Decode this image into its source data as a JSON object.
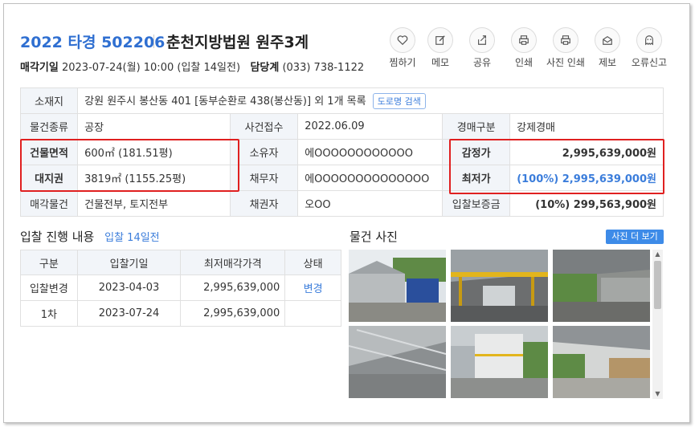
{
  "header": {
    "case_no": "2022 타경 502206",
    "court": "춘천지방법원 원주3계",
    "sale_date_label": "매각기일",
    "sale_date_value": "2023-07-24(월) 10:00 (입찰 14일전)",
    "manager_label": "담당계",
    "manager_value": "(033) 738-1122"
  },
  "actions": [
    {
      "label": "찜하기",
      "icon": "heart-icon"
    },
    {
      "label": "메모",
      "icon": "pencil-icon"
    },
    {
      "label": "공유",
      "icon": "share-icon"
    },
    {
      "label": "인쇄",
      "icon": "printer-icon"
    },
    {
      "label": "사진 인쇄",
      "icon": "printer-icon"
    },
    {
      "label": "제보",
      "icon": "envelope-icon"
    },
    {
      "label": "오류신고",
      "icon": "ghost-icon"
    }
  ],
  "info": {
    "location_label": "소재지",
    "location_value": "강원 원주시 봉산동 401 [동부순환로 438(봉산동)] 외 1개 목록",
    "road_search": "도로명 검색",
    "type_label": "물건종류",
    "type_value": "공장",
    "received_label": "사건접수",
    "received_value": "2022.06.09",
    "auction_type_label": "경매구분",
    "auction_type_value": "강제경매",
    "building_area_label": "건물면적",
    "building_area_value": "600㎡ (181.51평)",
    "owner_label": "소유자",
    "owner_value": "에OOOOOOOOOOOO",
    "appraisal_label": "감정가",
    "appraisal_value": "2,995,639,000원",
    "land_label": "대지권",
    "land_value": "3819㎡ (1155.25평)",
    "debtor_label": "채무자",
    "debtor_value": "에OOOOOOOOOOOOOO",
    "min_price_label": "최저가",
    "min_price_value": "(100%) 2,995,639,000원",
    "sale_object_label": "매각물건",
    "sale_object_value": "건물전부, 토지전부",
    "creditor_label": "채권자",
    "creditor_value": "오OO",
    "deposit_label": "입찰보증금",
    "deposit_value": "(10%) 299,563,900원"
  },
  "bids": {
    "title": "입찰 진행 내용",
    "subtitle": "입찰 14일전",
    "columns": [
      "구분",
      "입찰기일",
      "최저매각가격",
      "상태"
    ],
    "rows": [
      {
        "kind": "입찰변경",
        "date": "2023-04-03",
        "price": "2,995,639,000",
        "status": "변경"
      },
      {
        "kind": "1차",
        "date": "2023-07-24",
        "price": "2,995,639,000",
        "status": ""
      }
    ]
  },
  "photos": {
    "title": "물건 사진",
    "more_button": "사진 더 보기",
    "items": [
      "building-exterior-photo",
      "warehouse-interior-photo",
      "shed-interior-photo",
      "canopy-photo",
      "container-building-photo",
      "storage-interior-photo"
    ]
  },
  "colors": {
    "accent": "#2f6fd1",
    "link": "#3b7ddb",
    "highlight_box": "#e02020",
    "header_cell": "#f2f5f9"
  }
}
